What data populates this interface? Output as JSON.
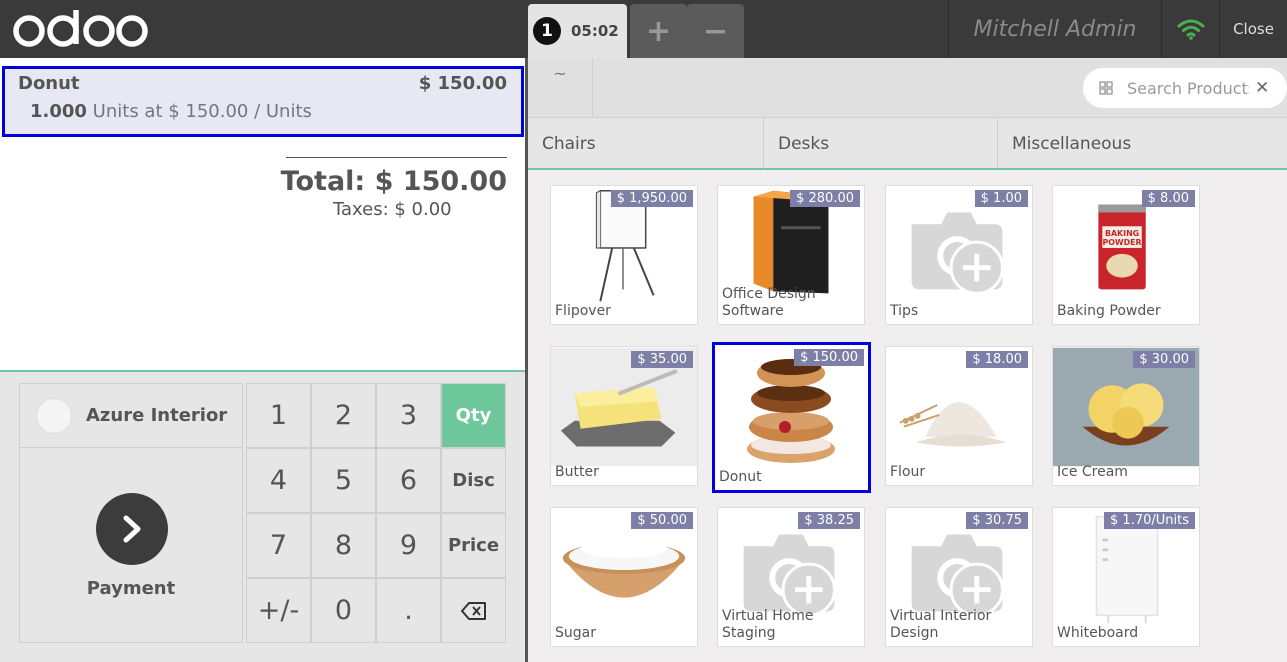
{
  "header": {
    "logo_text": "odoo",
    "order_number": "1",
    "order_time": "05:02",
    "add_order_label": "+",
    "remove_order_label": "−",
    "user_name": "Mitchell Admin",
    "close_label": "Close",
    "wifi_color": "#4caf50"
  },
  "order": {
    "line": {
      "name": "Donut",
      "price": "$ 150.00",
      "quantity": "1.000",
      "details": "Units at $ 150.00 / Units"
    },
    "total": "Total: $ 150.00",
    "taxes": "Taxes: $ 0.00"
  },
  "actionpad": {
    "customer": "Azure Interior",
    "payment_label": "Payment"
  },
  "numpad": {
    "keys": [
      "1",
      "2",
      "3",
      "Qty",
      "4",
      "5",
      "6",
      "Disc",
      "7",
      "8",
      "9",
      "Price",
      "+/-",
      "0",
      ".",
      "backspace"
    ],
    "active_mode": "Qty"
  },
  "breadcrumb": {
    "home": "~"
  },
  "search": {
    "placeholder": "Search Products"
  },
  "categories": [
    "Chairs",
    "Desks",
    "Miscellaneous"
  ],
  "products": [
    {
      "name": "Flipover",
      "price": "$ 1,950.00",
      "image": "flipover-easel"
    },
    {
      "name": "Office Design Software",
      "price": "$ 280.00",
      "image": "software-box"
    },
    {
      "name": "Tips",
      "price": "$ 1.00",
      "image": "placeholder-camera"
    },
    {
      "name": "Baking Powder",
      "price": "$ 8.00",
      "image": "baking-powder-can"
    },
    {
      "name": "Butter",
      "price": "$ 35.00",
      "image": "butter"
    },
    {
      "name": "Donut",
      "price": "$ 150.00",
      "image": "donuts",
      "selected": true
    },
    {
      "name": "Flour",
      "price": "$ 18.00",
      "image": "flour"
    },
    {
      "name": "Ice Cream",
      "price": "$ 30.00",
      "image": "ice-cream"
    },
    {
      "name": "Sugar",
      "price": "$ 50.00",
      "image": "sugar-bowl"
    },
    {
      "name": "Virtual Home Staging",
      "price": "$ 38.25",
      "image": "placeholder-camera"
    },
    {
      "name": "Virtual Interior Design",
      "price": "$ 30.75",
      "image": "placeholder-camera"
    },
    {
      "name": "Whiteboard",
      "price": "$ 1.70/Units",
      "image": "whiteboard"
    }
  ],
  "colors": {
    "accent_green": "#6ec89b",
    "selected_border": "#0000dd",
    "price_tag": "#7d7fa6",
    "header_bg": "#3a3a3a"
  }
}
